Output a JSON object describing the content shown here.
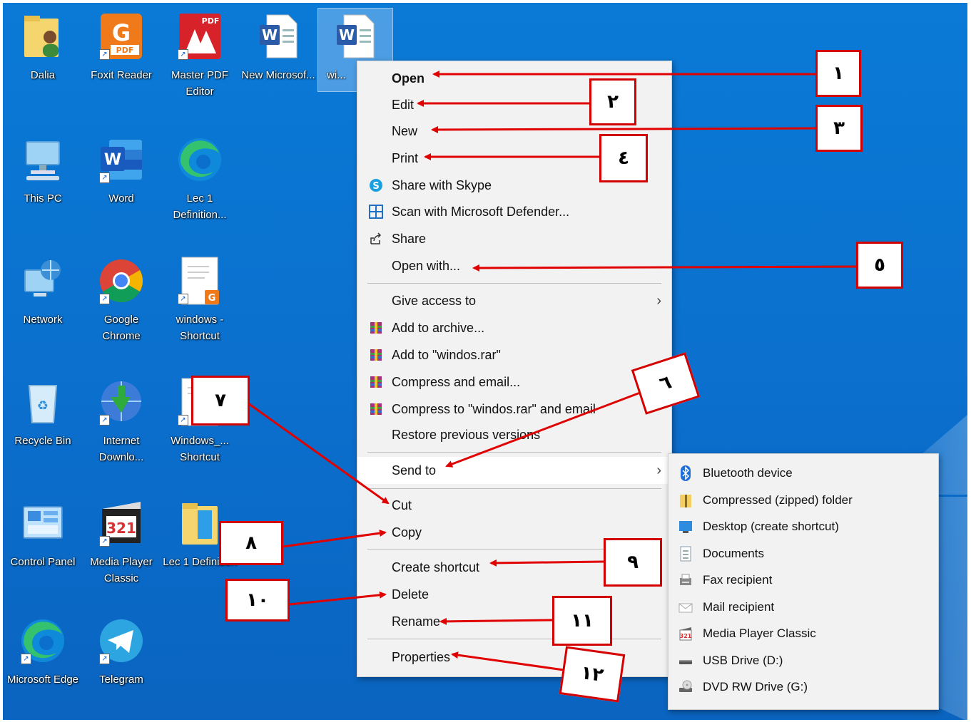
{
  "desktop_icons": [
    {
      "label": "Dalia",
      "icon": "user-folder-icon"
    },
    {
      "label": "Foxit Reader",
      "icon": "foxit-pdf-icon"
    },
    {
      "label": "Master PDF Editor",
      "icon": "master-pdf-icon"
    },
    {
      "label": "New Microsof...",
      "icon": "word-document-icon"
    },
    {
      "label": "wi...",
      "icon": "word-document-icon"
    },
    {
      "label": "This PC",
      "icon": "computer-icon"
    },
    {
      "label": "Word",
      "icon": "word-app-icon"
    },
    {
      "label": "Lec 1 Definition...",
      "icon": "edge-icon"
    },
    {
      "label": "Network",
      "icon": "network-icon"
    },
    {
      "label": "Google Chrome",
      "icon": "chrome-icon"
    },
    {
      "label": "windows - Shortcut",
      "icon": "document-shortcut-icon"
    },
    {
      "label": "Recycle Bin",
      "icon": "recycle-bin-icon"
    },
    {
      "label": "Internet Downlo...",
      "icon": "idm-icon"
    },
    {
      "label": "Windows_... Shortcut",
      "icon": "document-shortcut-icon"
    },
    {
      "label": "Control Panel",
      "icon": "control-panel-icon"
    },
    {
      "label": "Media Player Classic",
      "icon": "media-player-icon"
    },
    {
      "label": "Lec 1 Definition",
      "icon": "folder-icon"
    },
    {
      "label": "Microsoft Edge",
      "icon": "edge-icon"
    },
    {
      "label": "Telegram",
      "icon": "telegram-icon"
    }
  ],
  "context_menu": {
    "items": [
      {
        "label": "Open",
        "icon": ""
      },
      {
        "label": "Edit",
        "icon": ""
      },
      {
        "label": "New",
        "icon": ""
      },
      {
        "label": "Print",
        "icon": ""
      },
      {
        "label": "Share with Skype",
        "icon": "skype-icon"
      },
      {
        "label": "Scan with Microsoft Defender...",
        "icon": "defender-icon"
      },
      {
        "label": "Share",
        "icon": "share-icon"
      },
      {
        "label": "Open with...",
        "icon": ""
      },
      {
        "label": "Give access to",
        "icon": ""
      },
      {
        "label": "Add to archive...",
        "icon": "winrar-icon"
      },
      {
        "label": "Add to \"windos.rar\"",
        "icon": "winrar-icon"
      },
      {
        "label": "Compress and email...",
        "icon": "winrar-icon"
      },
      {
        "label": "Compress to \"windos.rar\" and email",
        "icon": "winrar-icon"
      },
      {
        "label": "Restore previous versions",
        "icon": ""
      },
      {
        "label": "Send to",
        "icon": ""
      },
      {
        "label": "Cut",
        "icon": ""
      },
      {
        "label": "Copy",
        "icon": ""
      },
      {
        "label": "Create shortcut",
        "icon": ""
      },
      {
        "label": "Delete",
        "icon": ""
      },
      {
        "label": "Rename",
        "icon": ""
      },
      {
        "label": "Properties",
        "icon": ""
      }
    ],
    "chevron": "›"
  },
  "send_to_menu": {
    "items": [
      {
        "label": "Bluetooth device",
        "icon": "bluetooth-icon"
      },
      {
        "label": "Compressed (zipped) folder",
        "icon": "zip-folder-icon"
      },
      {
        "label": "Desktop (create shortcut)",
        "icon": "desktop-icon"
      },
      {
        "label": "Documents",
        "icon": "documents-icon"
      },
      {
        "label": "Fax recipient",
        "icon": "fax-icon"
      },
      {
        "label": "Mail recipient",
        "icon": "mail-icon"
      },
      {
        "label": "Media Player Classic",
        "icon": "media-player-icon"
      },
      {
        "label": "USB Drive (D:)",
        "icon": "usb-drive-icon"
      },
      {
        "label": "DVD RW Drive (G:)",
        "icon": "dvd-drive-icon"
      }
    ]
  },
  "callouts": [
    "١",
    "٢",
    "٣",
    "٤",
    "٥",
    "٦",
    "٧",
    "٨",
    "٩",
    "١٠",
    "١١",
    "١٢"
  ],
  "colors": {
    "desktop": "#0b6fcd",
    "callout_border": "#d40000",
    "arrow": "#e00000",
    "menu_bg": "#f2f2f2"
  }
}
